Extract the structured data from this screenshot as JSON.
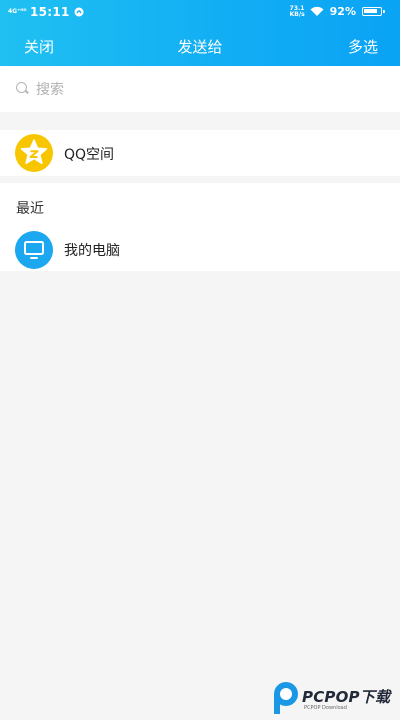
{
  "status_bar": {
    "network": "4G⁺ᴴᴰ",
    "time": "15:11",
    "speed": "73.1\nKB/s",
    "battery": "92%",
    "battery_level": 0.92
  },
  "nav": {
    "close_label": "关闭",
    "title": "发送给",
    "multi_select_label": "多选"
  },
  "search": {
    "placeholder": "搜索"
  },
  "shortcuts": [
    {
      "label": "QQ空间",
      "icon": "qzone-star-icon"
    }
  ],
  "recent": {
    "section_title": "最近",
    "items": [
      {
        "label": "我的电脑",
        "icon": "computer-monitor-icon"
      }
    ]
  },
  "watermark": {
    "text": "PCPOP下载",
    "subtext": "PCPOP Download"
  },
  "colors": {
    "header_start": "#20c0f2",
    "header_end": "#0aa3f5",
    "qzone_yellow": "#f7c600",
    "pc_blue": "#1ba8f0",
    "background": "#f5f5f5"
  }
}
